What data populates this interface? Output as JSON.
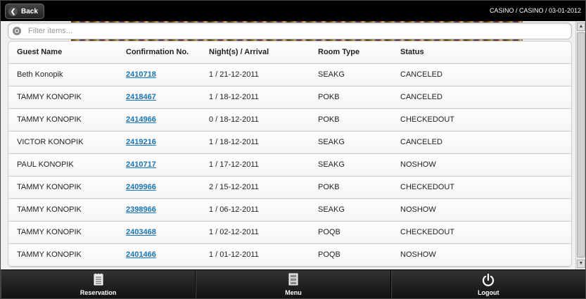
{
  "header": {
    "back_label": "Back",
    "breadcrumb": "CASINO / CASINO / 03-01-2012"
  },
  "filter": {
    "placeholder": "Filter items..."
  },
  "table": {
    "headers": [
      "Guest Name",
      "Confirmation No.",
      "Night(s) / Arrival",
      "Room Type",
      "Status"
    ],
    "rows": [
      {
        "guest": "Beth Konopik",
        "conf": "2410718",
        "nights": "1 / 21-12-2011",
        "room": "SEAKG",
        "status": "CANCELED"
      },
      {
        "guest": "TAMMY KONOPIK",
        "conf": "2418467",
        "nights": "1 / 18-12-2011",
        "room": "POKB",
        "status": "CANCELED"
      },
      {
        "guest": "TAMMY KONOPIK",
        "conf": "2414966",
        "nights": "0 / 18-12-2011",
        "room": "POKB",
        "status": "CHECKEDOUT"
      },
      {
        "guest": "VICTOR KONOPIK",
        "conf": "2419216",
        "nights": "1 / 18-12-2011",
        "room": "SEAKG",
        "status": "CANCELED"
      },
      {
        "guest": "PAUL KONOPIK",
        "conf": "2410717",
        "nights": "1 / 17-12-2011",
        "room": "SEAKG",
        "status": "NOSHOW"
      },
      {
        "guest": "TAMMY KONOPIK",
        "conf": "2409966",
        "nights": "2 / 15-12-2011",
        "room": "POKB",
        "status": "CHECKEDOUT"
      },
      {
        "guest": "TAMMY KONOPIK",
        "conf": "2398966",
        "nights": "1 / 06-12-2011",
        "room": "SEAKG",
        "status": "NOSHOW"
      },
      {
        "guest": "TAMMY KONOPIK",
        "conf": "2403468",
        "nights": "1 / 02-12-2011",
        "room": "POQB",
        "status": "CHECKEDOUT"
      },
      {
        "guest": "TAMMY KONOPIK",
        "conf": "2401466",
        "nights": "1 / 01-12-2011",
        "room": "POQB",
        "status": "NOSHOW"
      }
    ]
  },
  "footer": {
    "items": [
      {
        "label": "Reservation",
        "icon": "notepad-icon"
      },
      {
        "label": "Menu",
        "icon": "cabinet-icon"
      },
      {
        "label": "Logout",
        "icon": "power-icon"
      }
    ]
  },
  "colors": {
    "link": "#1a73b6",
    "header_bg": "#000000"
  }
}
